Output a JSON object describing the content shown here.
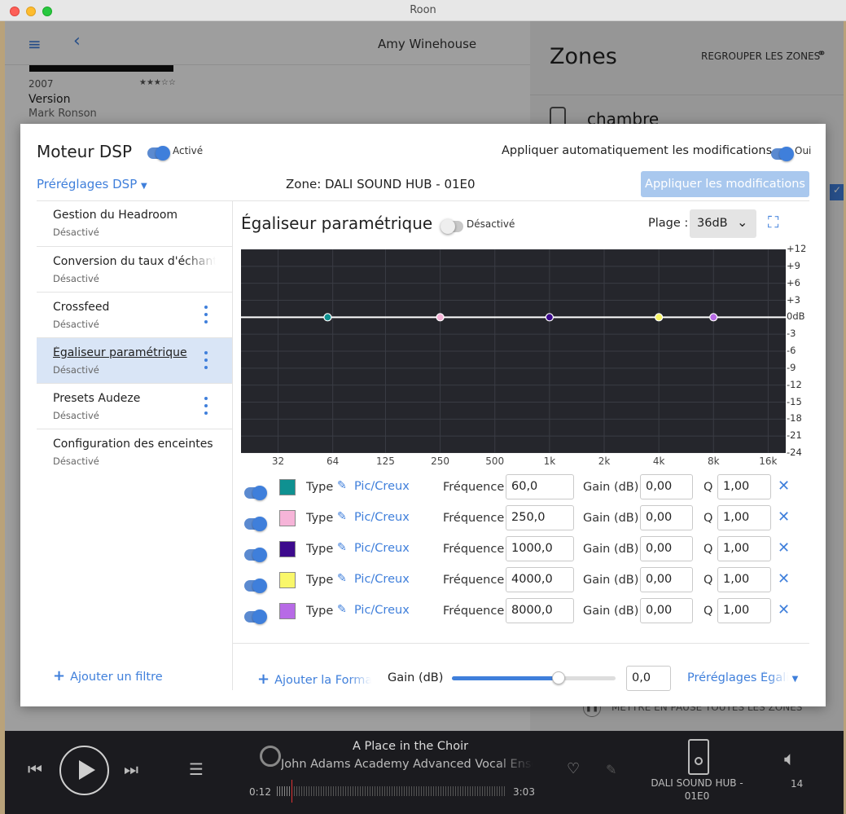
{
  "window": {
    "title": "Roon"
  },
  "bg": {
    "artist": "Amy Winehouse",
    "album_year": "2007",
    "album_rating": "★★★☆☆",
    "album_title": "Version",
    "album_artist": "Mark Ronson",
    "zones_title": "Zones",
    "group_zones": "REGROUPER LES ZONES",
    "zone_name": "chambre",
    "pause_all": "METTRE EN PAUSE TOUTES LES ZONES"
  },
  "dsp": {
    "title": "Moteur DSP",
    "enabled_label": "Activé",
    "auto_apply_label": "Appliquer automatiquement les modifications",
    "auto_apply_value": "Oui",
    "presets_label": "Préréglages DSP",
    "zone_label": "Zone: DALI SOUND HUB - 01E0",
    "apply_button": "Appliquer les modifications",
    "sidebar": [
      {
        "title": "Gestion du Headroom",
        "status": "Désactivé"
      },
      {
        "title": "Conversion du taux d'échantillonnage",
        "status": "Désactivé"
      },
      {
        "title": "Crossfeed",
        "status": "Désactivé"
      },
      {
        "title": "Égaliseur paramétrique",
        "status": "Désactivé"
      },
      {
        "title": "Presets Audeze",
        "status": "Désactivé"
      },
      {
        "title": "Configuration des enceintes",
        "status": "Désactivé"
      }
    ],
    "add_filter": "Ajouter un filtre"
  },
  "eq": {
    "title": "Égaliseur paramétrique",
    "state": "Désactivé",
    "range_label": "Plage :",
    "range_value": "36dB",
    "filters": [
      {
        "color": "#0f9191",
        "type_label": "Type",
        "type": "Pic/Creux",
        "freq_label": "Fréquence",
        "freq": "60,0",
        "gain_label": "Gain (dB)",
        "gain": "0,00",
        "q_label": "Q",
        "q": "1,00"
      },
      {
        "color": "#f6b4d8",
        "type_label": "Type",
        "type": "Pic/Creux",
        "freq_label": "Fréquence",
        "freq": "250,0",
        "gain_label": "Gain (dB)",
        "gain": "0,00",
        "q_label": "Q",
        "q": "1,00"
      },
      {
        "color": "#3d0a8d",
        "type_label": "Type",
        "type": "Pic/Creux",
        "freq_label": "Fréquence",
        "freq": "1000,0",
        "gain_label": "Gain (dB)",
        "gain": "0,00",
        "q_label": "Q",
        "q": "1,00"
      },
      {
        "color": "#f9f76a",
        "type_label": "Type",
        "type": "Pic/Creux",
        "freq_label": "Fréquence",
        "freq": "4000,0",
        "gain_label": "Gain (dB)",
        "gain": "0,00",
        "q_label": "Q",
        "q": "1,00"
      },
      {
        "color": "#b76ae6",
        "type_label": "Type",
        "type": "Pic/Creux",
        "freq_label": "Fréquence",
        "freq": "8000,0",
        "gain_label": "Gain (dB)",
        "gain": "0,00",
        "q_label": "Q",
        "q": "1,00"
      }
    ],
    "add_format": "Ajouter la Format",
    "gain_label": "Gain (dB)",
    "gain_value": "0,0",
    "gain_slider_fraction": 0.65,
    "presets_label": "Préréglages Égali"
  },
  "chart_data": {
    "type": "line",
    "xscale": "log",
    "xlim": [
      20,
      20000
    ],
    "ylim": [
      -24,
      12
    ],
    "x_ticks": [
      "32",
      "64",
      "125",
      "250",
      "500",
      "1k",
      "2k",
      "4k",
      "8k",
      "16k"
    ],
    "y_ticks": [
      "+12",
      "+9",
      "+6",
      "+3",
      "0dB",
      "-3",
      "-6",
      "-9",
      "-12",
      "-15",
      "-18",
      "-21",
      "-24"
    ],
    "series": [
      {
        "x": [
          20,
          20000
        ],
        "y": [
          0,
          0
        ]
      }
    ],
    "points": [
      {
        "x": 60,
        "y": 0,
        "color": "#0f9191"
      },
      {
        "x": 250,
        "y": 0,
        "color": "#f6b4d8"
      },
      {
        "x": 1000,
        "y": 0,
        "color": "#3d0a8d"
      },
      {
        "x": 4000,
        "y": 0,
        "color": "#f9f76a"
      },
      {
        "x": 8000,
        "y": 0,
        "color": "#b76ae6"
      }
    ]
  },
  "player": {
    "track": "A Place in the Choir",
    "artist": "John Adams Academy Advanced Vocal Ensem",
    "elapsed": "0:12",
    "duration": "3:03",
    "progress_fraction": 0.066,
    "zone": "DALI SOUND HUB - 01E0",
    "volume": "14"
  }
}
